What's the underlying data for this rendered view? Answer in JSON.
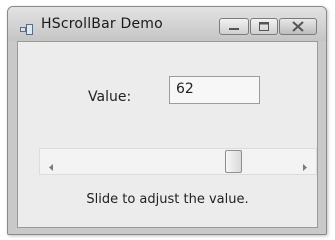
{
  "window": {
    "title": "HScrollBar Demo"
  },
  "form": {
    "value_label": "Value:",
    "value": "62",
    "scrollbar": {
      "value": 62
    },
    "hint": "Slide to adjust the value."
  }
}
